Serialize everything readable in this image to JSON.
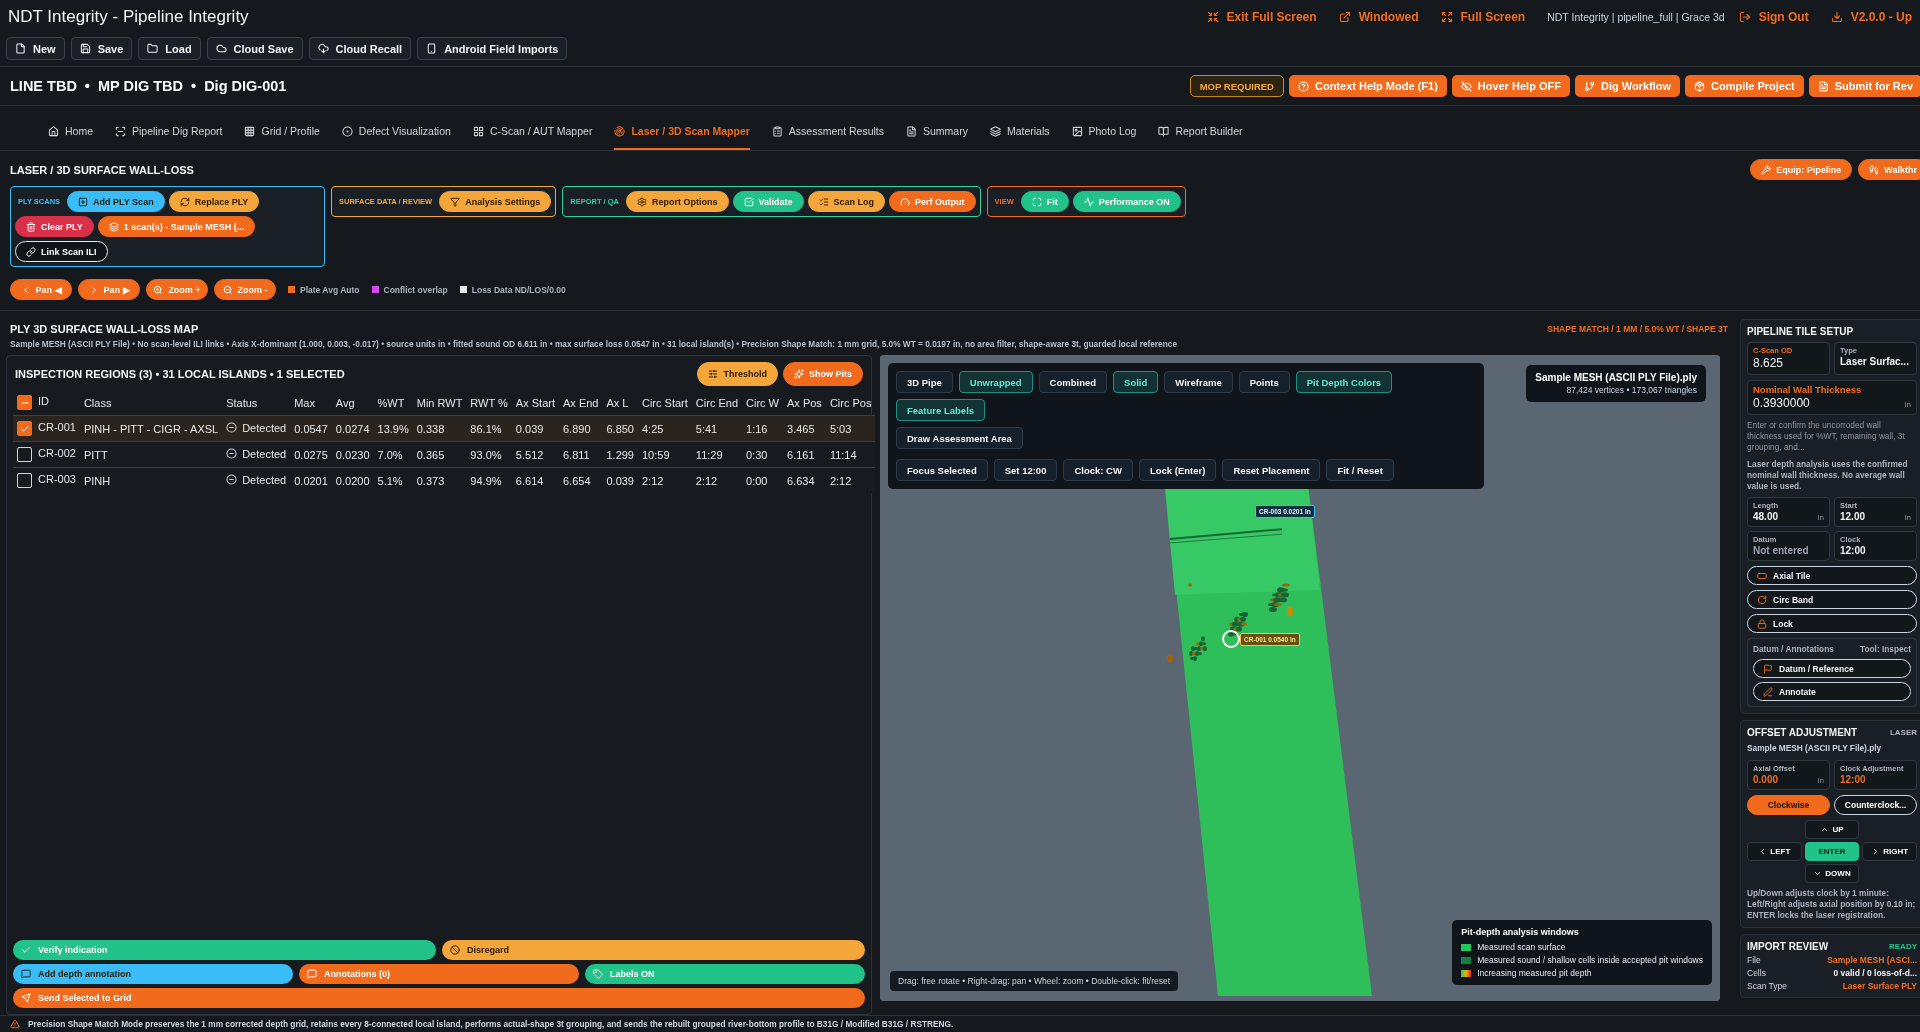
{
  "window": {
    "title": "NDT Integrity - Pipeline Integrity"
  },
  "top_actions": [
    {
      "kind": "action",
      "label": "Exit Full Screen"
    },
    {
      "kind": "action",
      "label": "Windowed"
    },
    {
      "kind": "action",
      "label": "Full Screen"
    },
    {
      "kind": "info",
      "label": "NDT Integrity | pipeline_full | Grace 3d"
    },
    {
      "kind": "action",
      "label": "Sign Out"
    },
    {
      "kind": "action",
      "label": "V2.0.0 - Up"
    }
  ],
  "file_toolbar": [
    "New",
    "Save",
    "Load",
    "Cloud Save",
    "Cloud Recall",
    "Android Field Imports"
  ],
  "dig_header": {
    "parts": [
      "LINE TBD",
      "MP DIG TBD",
      "Dig DIG-001"
    ],
    "separator": "•"
  },
  "header_buttons": [
    {
      "kind": "badge",
      "label": "MOP REQUIRED"
    },
    {
      "kind": "button",
      "label": "Context Help Mode (F1)"
    },
    {
      "kind": "button",
      "label": "Hover Help OFF"
    },
    {
      "kind": "button",
      "label": "Dig Workflow"
    },
    {
      "kind": "button",
      "label": "Compile Project"
    },
    {
      "kind": "button",
      "label": "Submit for Rev"
    }
  ],
  "nav_tabs": [
    {
      "label": "Home",
      "selected": false
    },
    {
      "label": "Pipeline Dig Report",
      "selected": false
    },
    {
      "label": "Grid / Profile",
      "selected": false
    },
    {
      "label": "Defect Visualization",
      "selected": false
    },
    {
      "label": "C-Scan / AUT Mapper",
      "selected": false
    },
    {
      "label": "Laser / 3D Scan Mapper",
      "selected": true
    },
    {
      "label": "Assessment Results",
      "selected": false
    },
    {
      "label": "Summary",
      "selected": false
    },
    {
      "label": "Materials",
      "selected": false
    },
    {
      "label": "Photo Log",
      "selected": false
    },
    {
      "label": "Report Builder",
      "selected": false
    }
  ],
  "section": {
    "title": "LASER / 3D SURFACE WALL-LOSS",
    "buttons": [
      "Equip: Pipeline",
      "Walkthr"
    ]
  },
  "tool_groups": [
    {
      "title": "PLY SCANS",
      "color": "#38bdf8",
      "buttons": [
        {
          "label": "Add PLY Scan",
          "color": "#38bdf8"
        },
        {
          "label": "Replace PLY",
          "color": "#f5a63a"
        },
        {
          "label": "Clear PLY",
          "color": "#d9304a"
        },
        {
          "label": "1 scan(s) - Sample MESH (...",
          "color": "#f26b1d"
        },
        {
          "label": "Link Scan ILI",
          "color": "#111418"
        }
      ]
    },
    {
      "title": "SURFACE DATA / REVIEW",
      "color": "#f5a63a",
      "buttons": [
        {
          "label": "Analysis Settings",
          "color": "#f5a63a"
        }
      ]
    },
    {
      "title": "REPORT / QA",
      "color": "#2dd4a0",
      "buttons": [
        {
          "label": "Report Options",
          "color": "#f5a63a"
        },
        {
          "label": "Validate",
          "color": "#22c38a"
        },
        {
          "label": "Scan Log",
          "color": "#f5a63a"
        },
        {
          "label": "Perf Output",
          "color": "#f26b1d"
        }
      ]
    },
    {
      "title": "VIEW",
      "color": "#f26b1d",
      "buttons": [
        {
          "label": "Fit",
          "color": "#22c38a"
        },
        {
          "label": "Performance ON",
          "color": "#22c38a"
        }
      ]
    }
  ],
  "nav_controls": [
    "Pan ◀",
    "Pan ▶",
    "Zoom +",
    "Zoom -"
  ],
  "legend": [
    {
      "label": "Plate Avg Auto",
      "color": "#f26b1d"
    },
    {
      "label": "Conflict overlap",
      "color": "#d946ef"
    },
    {
      "label": "Loss Data ND/LOS/0.00",
      "color": "#e5e7eb"
    }
  ],
  "map": {
    "title": "PLY 3D SURFACE WALL-LOSS MAP",
    "badge": "SHAPE MATCH / 1 MM / 5.0% WT / SHAPE 3T",
    "subtitle": "Sample MESH (ASCII PLY File) • No scan-level ILI links • Axis X-dominant (1.000, 0.003, -0.017) • source units in • fitted sound OD 6.611 in • max surface loss 0.0547 in • 31 local island(s) • Precision Shape Match: 1 mm grid, 5.0% WT = 0.0197 in, no area filter, shape-aware 3t, guarded local reference"
  },
  "regions": {
    "title": "INSPECTION REGIONS (3) • 31 LOCAL ISLANDS • 1 SELECTED",
    "buttons": [
      {
        "label": "Threshold",
        "color": "#f5a63a"
      },
      {
        "label": "Show Pits",
        "color": "#f26b1d"
      }
    ],
    "some_selected": true,
    "columns": [
      "ID",
      "Class",
      "Status",
      "Max",
      "Avg",
      "%WT",
      "Min RWT",
      "RWT %",
      "Ax Start",
      "Ax End",
      "Ax L",
      "Circ Start",
      "Circ End",
      "Circ W",
      "Ax Pos",
      "Circ Pos"
    ],
    "rows": [
      {
        "selected": true,
        "id": "CR-001",
        "class": "PINH - PITT - CIGR - AXSL",
        "status": "Detected",
        "values": [
          "0.0547",
          "0.0274",
          "13.9%",
          "0.338",
          "86.1%",
          "0.039",
          "6.890",
          "6.850",
          "4:25",
          "5:41",
          "1:16",
          "3.465",
          "5:03"
        ]
      },
      {
        "selected": false,
        "id": "CR-002",
        "class": "PITT",
        "status": "Detected",
        "values": [
          "0.0275",
          "0.0230",
          "7.0%",
          "0.365",
          "93.0%",
          "5.512",
          "6.811",
          "1.299",
          "10:59",
          "11:29",
          "0:30",
          "6.161",
          "11:14"
        ]
      },
      {
        "selected": false,
        "id": "CR-003",
        "class": "PINH",
        "status": "Detected",
        "values": [
          "0.0201",
          "0.0200",
          "5.1%",
          "0.373",
          "94.9%",
          "6.614",
          "6.654",
          "0.039",
          "2:12",
          "2:12",
          "0:00",
          "6.634",
          "2:12"
        ]
      }
    ]
  },
  "actions": [
    [
      {
        "label": "Verify indication",
        "color": "#22c38a"
      },
      {
        "label": "Disregard",
        "color": "#f5a63a"
      }
    ],
    [
      {
        "label": "Add depth annotation",
        "color": "#38bdf8"
      },
      {
        "label": "Annotations (0)",
        "color": "#f26b1d"
      },
      {
        "label": "Labels ON",
        "color": "#22c38a"
      }
    ],
    [
      {
        "label": "Send Selected to Grid",
        "color": "#f26b1d"
      }
    ]
  ],
  "viewport": {
    "modes": [
      {
        "label": "3D Pipe",
        "active": false
      },
      {
        "label": "Unwrapped",
        "active": true
      },
      {
        "label": "Combined",
        "active": false
      },
      {
        "label": "Solid",
        "active": true
      },
      {
        "label": "Wireframe",
        "active": false
      },
      {
        "label": "Points",
        "active": false
      },
      {
        "label": "Pit Depth Colors",
        "active": true
      },
      {
        "label": "Feature Labels",
        "active": true
      }
    ],
    "draw_button": "Draw Assessment Area",
    "controls": [
      "Focus Selected",
      "Set 12:00",
      "Clock: CW",
      "Lock (Enter)",
      "Reset Placement",
      "Fit / Reset"
    ],
    "file": {
      "name": "Sample MESH (ASCII PLY File).ply",
      "stats": "87,424 vertices • 173,067 triangles"
    },
    "markers": [
      {
        "label": "CR-003 0.0201 in",
        "selected": false
      },
      {
        "label": "CR-001 0.0540 in",
        "selected": true
      }
    ],
    "hint": "Drag: free rotate • Right-drag: pan • Wheel: zoom • Double-click: fit/reset",
    "legend": {
      "title": "Pit-depth analysis windows",
      "items": [
        {
          "kind": "solid",
          "color": "#22c55e",
          "label": "Measured scan surface"
        },
        {
          "kind": "solid",
          "color": "#15803d",
          "label": "Measured sound / shallow cells inside accepted pit windows"
        },
        {
          "kind": "gradient",
          "label": "Increasing measured pit depth"
        }
      ]
    }
  },
  "tile_setup": {
    "title": "PIPELINE TILE SETUP",
    "od": {
      "label": "C-Scan OD",
      "value": "8.625"
    },
    "type": {
      "label": "Type",
      "value": "Laser Surfac..."
    },
    "wall": {
      "label": "Nominal Wall Thickness",
      "value": "0.3930000",
      "unit": "in"
    },
    "hint": "Enter or confirm the uncorroded wall thickness used for %WT, remaining wall, 3t grouping, and...",
    "note": "Laser depth analysis uses the confirmed nominal wall thickness. No average wall value is used.",
    "fields": [
      {
        "label": "Length",
        "value": "48.00",
        "unit": "in"
      },
      {
        "label": "Start",
        "value": "12.00",
        "unit": "in"
      },
      {
        "label": "Datum",
        "placeholder": "Not entered"
      },
      {
        "label": "Clock",
        "value": "12:00"
      }
    ],
    "tools": [
      "Axial Tile",
      "Circ Band",
      "Lock"
    ],
    "annotations": {
      "label": "Datum / Annotations",
      "tool": "Tool: Inspect",
      "buttons": [
        "Datum / Reference",
        "Annotate"
      ]
    }
  },
  "offset": {
    "title": "OFFSET ADJUSTMENT",
    "tag": "LASER",
    "file": "Sample MESH (ASCII PLY File).ply",
    "fields": [
      {
        "label": "Axial Offset",
        "value": "0.000",
        "unit": "in"
      },
      {
        "label": "Clock Adjustment",
        "value": "12:00"
      }
    ],
    "direction": [
      {
        "label": "Clockwise",
        "selected": true
      },
      {
        "label": "Counterclock...",
        "selected": false
      }
    ],
    "pad": {
      "up": "UP",
      "left": "LEFT",
      "enter": "ENTER",
      "right": "RIGHT",
      "down": "DOWN"
    },
    "note": "Up/Down adjusts clock by 1 minute: Left/Right adjusts axial position by 0.10 in; ENTER locks the laser registration."
  },
  "import_review": {
    "title": "IMPORT REVIEW",
    "status": "READY",
    "rows": [
      {
        "kind": "accent",
        "label": "File",
        "value": "Sample MESH (ASCI..."
      },
      {
        "kind": "plain",
        "label": "Cells",
        "value": "0 valid / 0 loss-of-d..."
      },
      {
        "kind": "accent",
        "label": "Scan Type",
        "value": "Laser Surface PLY"
      }
    ]
  },
  "status_bar": "Precision Shape Match Mode preserves the 1 mm corrected depth grid, retains every 8-connected local island, performs actual-shape 3t grouping, and sends the rebuilt grouped river-bottom profile to B31G / Modified B31G / RSTRENG."
}
